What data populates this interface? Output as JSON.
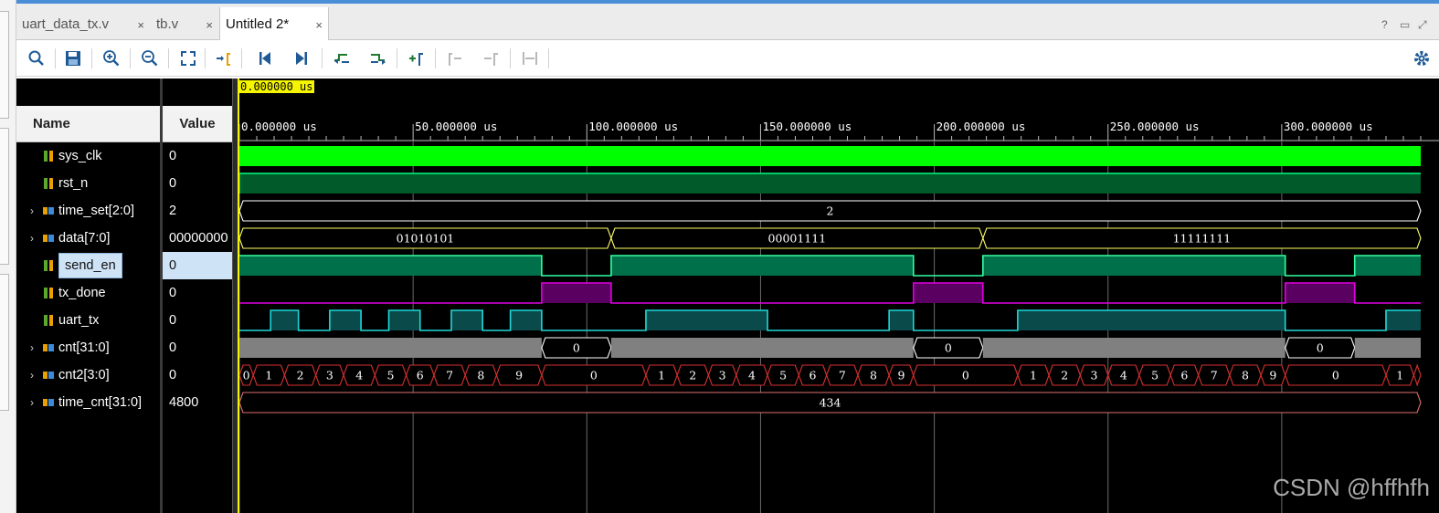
{
  "tabs": [
    {
      "label": "uart_data_tx.v",
      "active": false
    },
    {
      "label": "tb.v",
      "active": false
    },
    {
      "label": "Untitled 2*",
      "active": true
    }
  ],
  "tab_close_glyph": "×",
  "window_controls": [
    "?",
    "▭",
    "⤢"
  ],
  "toolbar": {
    "icons": [
      "search-icon",
      "save-icon",
      "zoom-in-icon",
      "zoom-out-icon",
      "zoom-fit-icon",
      "go-to-cursor-icon",
      "go-to-start-icon",
      "go-to-end-icon",
      "previous-transition-icon",
      "next-transition-icon",
      "add-marker-icon",
      "previous-marker-icon",
      "next-marker-icon",
      "swap-cursors-icon",
      "settings-gear-icon"
    ]
  },
  "waveform": {
    "cursor_time": "0.000000 us",
    "columns": {
      "name": "Name",
      "value": "Value"
    },
    "time_axis": {
      "unit": "us",
      "start": 0,
      "end": 340,
      "major_tick_step": 50,
      "labels": [
        "0.000000 us",
        "50.000000 us",
        "100.000000 us",
        "150.000000 us",
        "200.000000 us",
        "250.000000 us",
        "300.000000 us"
      ]
    },
    "signals": [
      {
        "name": "sys_clk",
        "value": "0",
        "type": "clock",
        "expandable": false,
        "selected": false
      },
      {
        "name": "rst_n",
        "value": "0",
        "type": "bit",
        "expandable": false,
        "selected": false
      },
      {
        "name": "time_set[2:0]",
        "value": "2",
        "type": "bus",
        "expandable": true,
        "selected": false
      },
      {
        "name": "data[7:0]",
        "value": "00000000",
        "type": "bus",
        "expandable": true,
        "selected": false
      },
      {
        "name": "send_en",
        "value": "0",
        "type": "bit",
        "expandable": false,
        "selected": true
      },
      {
        "name": "tx_done",
        "value": "0",
        "type": "bit",
        "expandable": false,
        "selected": false
      },
      {
        "name": "uart_tx",
        "value": "0",
        "type": "bit",
        "expandable": false,
        "selected": false
      },
      {
        "name": "cnt[31:0]",
        "value": "0",
        "type": "bus",
        "expandable": true,
        "selected": false
      },
      {
        "name": "cnt2[3:0]",
        "value": "0",
        "type": "bus",
        "expandable": true,
        "selected": false
      },
      {
        "name": "time_cnt[31:0]",
        "value": "4800",
        "type": "bus",
        "expandable": true,
        "selected": false
      }
    ],
    "segments": {
      "time_set": [
        {
          "t0": 0,
          "t1": 340,
          "label": "2"
        }
      ],
      "data": [
        {
          "t0": 0,
          "t1": 107,
          "label": "01010101"
        },
        {
          "t0": 107,
          "t1": 214,
          "label": "00001111"
        },
        {
          "t0": 214,
          "t1": 340,
          "label": "11111111"
        }
      ],
      "cnt": [
        {
          "t0": 0,
          "t1": 87,
          "label": "",
          "kind": "busy"
        },
        {
          "t0": 87,
          "t1": 107,
          "label": "0",
          "kind": "idle"
        },
        {
          "t0": 107,
          "t1": 194,
          "label": "",
          "kind": "busy"
        },
        {
          "t0": 194,
          "t1": 214,
          "label": "0",
          "kind": "idle"
        },
        {
          "t0": 214,
          "t1": 301,
          "label": "",
          "kind": "busy"
        },
        {
          "t0": 301,
          "t1": 321,
          "label": "0",
          "kind": "idle"
        },
        {
          "t0": 321,
          "t1": 340,
          "label": "",
          "kind": "busy"
        }
      ],
      "cnt2": [
        {
          "t0": 0,
          "t1": 4,
          "label": "0"
        },
        {
          "t0": 4,
          "t1": 13,
          "label": "1"
        },
        {
          "t0": 13,
          "t1": 22,
          "label": "2"
        },
        {
          "t0": 22,
          "t1": 30,
          "label": "3"
        },
        {
          "t0": 30,
          "t1": 39,
          "label": "4"
        },
        {
          "t0": 39,
          "t1": 48,
          "label": "5"
        },
        {
          "t0": 48,
          "t1": 56,
          "label": "6"
        },
        {
          "t0": 56,
          "t1": 65,
          "label": "7"
        },
        {
          "t0": 65,
          "t1": 74,
          "label": "8"
        },
        {
          "t0": 74,
          "t1": 87,
          "label": "9"
        },
        {
          "t0": 87,
          "t1": 117,
          "label": "0"
        },
        {
          "t0": 117,
          "t1": 126,
          "label": "1"
        },
        {
          "t0": 126,
          "t1": 135,
          "label": "2"
        },
        {
          "t0": 135,
          "t1": 143,
          "label": "3"
        },
        {
          "t0": 143,
          "t1": 152,
          "label": "4"
        },
        {
          "t0": 152,
          "t1": 161,
          "label": "5"
        },
        {
          "t0": 161,
          "t1": 169,
          "label": "6"
        },
        {
          "t0": 169,
          "t1": 178,
          "label": "7"
        },
        {
          "t0": 178,
          "t1": 187,
          "label": "8"
        },
        {
          "t0": 187,
          "t1": 194,
          "label": "9"
        },
        {
          "t0": 194,
          "t1": 224,
          "label": "0"
        },
        {
          "t0": 224,
          "t1": 233,
          "label": "1"
        },
        {
          "t0": 233,
          "t1": 242,
          "label": "2"
        },
        {
          "t0": 242,
          "t1": 250,
          "label": "3"
        },
        {
          "t0": 250,
          "t1": 259,
          "label": "4"
        },
        {
          "t0": 259,
          "t1": 268,
          "label": "5"
        },
        {
          "t0": 268,
          "t1": 276,
          "label": "6"
        },
        {
          "t0": 276,
          "t1": 285,
          "label": "7"
        },
        {
          "t0": 285,
          "t1": 294,
          "label": "8"
        },
        {
          "t0": 294,
          "t1": 301,
          "label": "9"
        },
        {
          "t0": 301,
          "t1": 330,
          "label": "0"
        },
        {
          "t0": 330,
          "t1": 338,
          "label": "1"
        },
        {
          "t0": 338,
          "t1": 340,
          "label": ""
        }
      ],
      "time_cnt": [
        {
          "t0": 0,
          "t1": 340,
          "label": "434"
        }
      ]
    },
    "transitions": {
      "send_en": {
        "initial": 1,
        "edges": [
          87,
          107,
          194,
          214,
          301,
          321
        ]
      },
      "tx_done": {
        "initial": 0,
        "edges": [
          87,
          107,
          194,
          214,
          301,
          321
        ]
      },
      "uart_tx": {
        "initial": 0,
        "edges": [
          9,
          17,
          26,
          35,
          43,
          52,
          61,
          70,
          78,
          87,
          117,
          152,
          187,
          194,
          224,
          301,
          330
        ]
      }
    }
  },
  "colors": {
    "clock": "#00ff00",
    "bit_fill": "#005a2a",
    "bit_edge": "#00ff7f",
    "send_en_fill": "#00704a",
    "send_en_edge": "#33ffa0",
    "tx_done_fill": "#5a0060",
    "tx_done_edge": "#e000e0",
    "uart_fill": "#0a4a4a",
    "uart_edge": "#20d8d8",
    "bus_outline": "#ffffff",
    "data_outline": "#ffff66",
    "cnt_busy": "#808080",
    "cnt2_outline": "#d83030",
    "time_cnt_outline": "#e07070",
    "cursor": "#f5f500",
    "grid": "#6a6a6a"
  },
  "watermark": "CSDN @hffhfh"
}
